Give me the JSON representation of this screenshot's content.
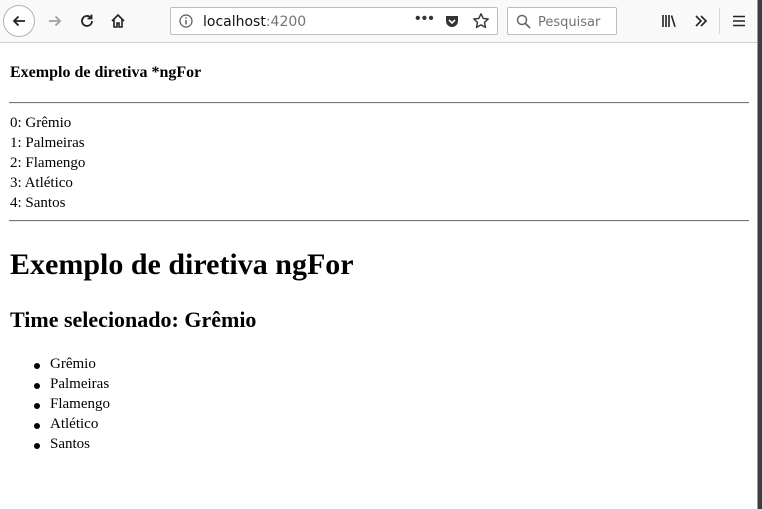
{
  "browser": {
    "url_host": "localhost",
    "url_port": ":4200",
    "search_placeholder": "Pesquisar"
  },
  "page": {
    "heading_small": "Exemplo de diretiva *ngFor",
    "indexed_list": [
      "0: Grêmio",
      "1: Palmeiras",
      "2: Flamengo",
      "3: Atlético",
      "4: Santos"
    ],
    "heading_large": "Exemplo de diretiva ngFor",
    "selected_heading": "Time selecionado: Grêmio",
    "bullet_list": [
      "Grêmio",
      "Palmeiras",
      "Flamengo",
      "Atlético",
      "Santos"
    ]
  }
}
